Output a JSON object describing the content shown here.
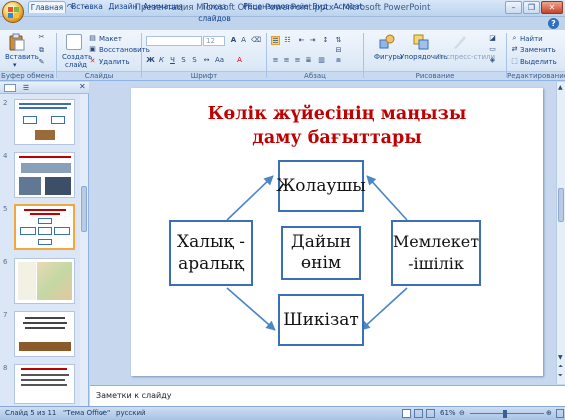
{
  "window": {
    "title": "Презентация Microsoft Office PowerPoint.pptx - Microsoft PowerPoint"
  },
  "tabs": [
    "Главная",
    "Вставка",
    "Дизайн",
    "Анимация",
    "Показ слайдов",
    "Рецензирование",
    "Вид",
    "Acrobat"
  ],
  "active_tab": "Главная",
  "ribbon": {
    "clipboard": {
      "label": "Буфер обмена",
      "paste": "Вставить"
    },
    "slides": {
      "label": "Слайды",
      "new_slide_l1": "Создать",
      "new_slide_l2": "слайд",
      "layout": "Макет",
      "reset": "Восстановить",
      "delete": "Удалить"
    },
    "font": {
      "label": "Шрифт",
      "size": "12"
    },
    "paragraph": {
      "label": "Абзац"
    },
    "drawing": {
      "label": "Рисование",
      "shapes": "Фигуры",
      "arrange": "Упорядочить",
      "quick_styles": "Экспресс-стили"
    },
    "editing": {
      "label": "Редактирование",
      "find": "Найти",
      "replace": "Заменить",
      "select": "Выделить"
    }
  },
  "thumbnails": [
    {
      "num": "2",
      "selected": false
    },
    {
      "num": "4",
      "selected": false
    },
    {
      "num": "5",
      "selected": true
    },
    {
      "num": "6",
      "selected": false
    },
    {
      "num": "7",
      "selected": false
    },
    {
      "num": "8",
      "selected": false
    }
  ],
  "slide": {
    "title_line1": "Көлік жүйесінің маңызы",
    "title_line2": "даму бағыттары",
    "box_top": "Жолаушы",
    "box_center_line1": "Дайын",
    "box_center_line2": "өнім",
    "box_left_line1": "Халық -",
    "box_left_line2": "аралық",
    "box_right_line1": "Мемлекет",
    "box_right_line2": "-ішілік",
    "box_bottom": "Шикізат"
  },
  "notes_placeholder": "Заметки к слайду",
  "status": {
    "slide_info": "Слайд 5 из 11",
    "theme": "\"Тема Office\"",
    "language": "русский",
    "zoom": "61%"
  },
  "colors": {
    "title_red": "#c00000",
    "box_border": "#3b6fb6",
    "arrow": "#4a86c8"
  }
}
